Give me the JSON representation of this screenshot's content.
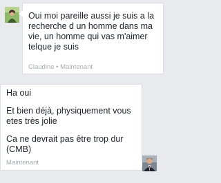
{
  "incoming": {
    "avatar": "user-photo-green",
    "message": "Oui moi pareille aussi je suis a la recherche d un homme dans ma vie, un homme qui vas m'aimer telque je suis",
    "sender": "Claudine",
    "separator": "•",
    "time": "Maintenant"
  },
  "outgoing": {
    "avatar": "user-photo-man-suit",
    "lines": [
      "Ha oui",
      "Et bien déjà, physiquement vous etes très jolie",
      "Ca ne devrait pas être trop dur (CMB)"
    ],
    "time": "Maintenant"
  }
}
